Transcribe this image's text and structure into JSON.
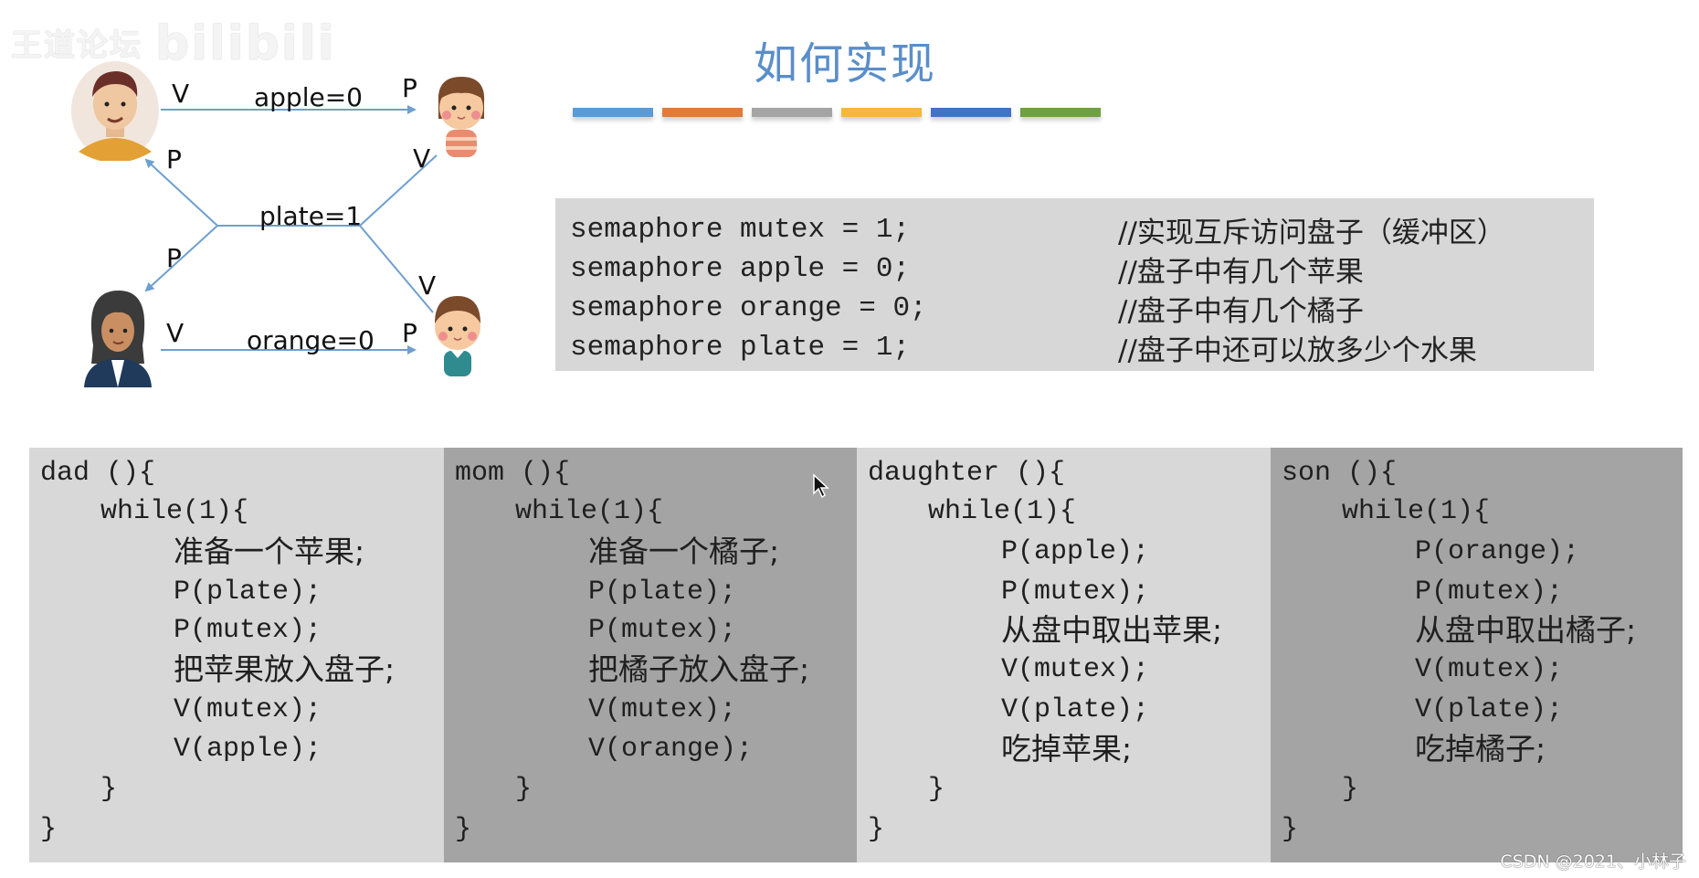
{
  "watermark": {
    "text": "王道论坛",
    "logo": "bilibili"
  },
  "title": "如何实现",
  "color_bars": [
    "#5b9bd5",
    "#e07b39",
    "#a5a5a5",
    "#f6b73c",
    "#4472c4",
    "#70a044"
  ],
  "diagram": {
    "arrow_color": "#6f9fd0",
    "nodes": [
      {
        "role": "dad",
        "icon": "man-avatar-icon"
      },
      {
        "role": "daughter",
        "icon": "girl-avatar-icon"
      },
      {
        "role": "mom",
        "icon": "woman-avatar-icon"
      },
      {
        "role": "son",
        "icon": "boy-avatar-icon"
      }
    ],
    "labels": {
      "apple": "apple=0",
      "plate": "plate=1",
      "orange": "orange=0",
      "dad_apple_v": "V",
      "daughter_apple_p": "P",
      "dad_plate_p": "P",
      "daughter_plate_v": "V",
      "mom_plate_p": "P",
      "son_plate_v": "V",
      "mom_orange_v": "V",
      "son_orange_p": "P"
    }
  },
  "semaphores": [
    {
      "code": "semaphore mutex = 1;",
      "comment": "//实现互斥访问盘子（缓冲区）"
    },
    {
      "code": "semaphore apple = 0;",
      "comment": "//盘子中有几个苹果"
    },
    {
      "code": "semaphore orange = 0;",
      "comment": "//盘子中有几个橘子"
    },
    {
      "code": "semaphore plate = 1;",
      "comment": "//盘子中还可以放多少个水果"
    }
  ],
  "panels": [
    {
      "name": "dad",
      "lines": [
        "dad (){",
        "while(1){",
        "准备一个苹果;",
        "P(plate);",
        "P(mutex);",
        "把苹果放入盘子;",
        "V(mutex);",
        "V(apple);",
        "}",
        "}"
      ]
    },
    {
      "name": "mom",
      "lines": [
        "mom (){",
        "while(1){",
        "准备一个橘子;",
        "P(plate);",
        "P(mutex);",
        "把橘子放入盘子;",
        "V(mutex);",
        "V(orange);",
        "}",
        "}"
      ]
    },
    {
      "name": "daughter",
      "lines": [
        "daughter (){",
        "while(1){",
        "P(apple);",
        "P(mutex);",
        "从盘中取出苹果;",
        "V(mutex);",
        "V(plate);",
        "吃掉苹果;",
        "}",
        "}"
      ]
    },
    {
      "name": "son",
      "lines": [
        "son (){",
        "while(1){",
        "P(orange);",
        "P(mutex);",
        "从盘中取出橘子;",
        "V(mutex);",
        "V(plate);",
        "吃掉橘子;",
        "}",
        "}"
      ]
    }
  ],
  "footer_watermark": "CSDN @2021、小林子"
}
